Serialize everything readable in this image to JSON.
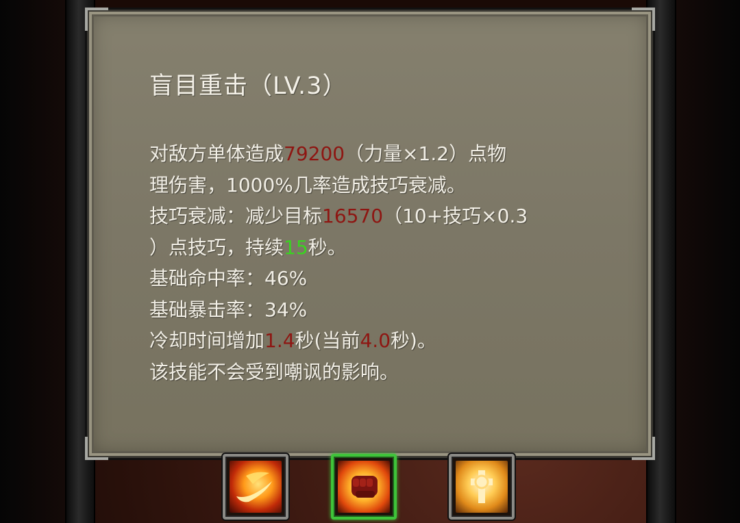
{
  "skill": {
    "title": "盲目重击（LV.3）",
    "lines": [
      [
        {
          "t": "对敌方单体造成"
        },
        {
          "t": "79200",
          "c": "red"
        },
        {
          "t": "（力量×1.2）点物"
        }
      ],
      [
        {
          "t": "理伤害，1000%几率造成技巧衰减。"
        }
      ],
      [
        {
          "t": "技巧衰减：减少目标"
        },
        {
          "t": "16570",
          "c": "red"
        },
        {
          "t": "（10+技巧×0.3"
        }
      ],
      [
        {
          "t": "）点技巧，持续"
        },
        {
          "t": "15",
          "c": "green"
        },
        {
          "t": "秒。"
        }
      ],
      [
        {
          "t": "基础命中率：46%"
        }
      ],
      [
        {
          "t": "基础暴击率：34%"
        }
      ],
      [
        {
          "t": "冷却时间增加"
        },
        {
          "t": "1.4",
          "c": "red"
        },
        {
          "t": "秒(当前"
        },
        {
          "t": "4.0",
          "c": "red"
        },
        {
          "t": "秒)。"
        }
      ],
      [
        {
          "t": "该技能不会受到嘲讽的影响。"
        }
      ]
    ]
  },
  "skill_bar": [
    {
      "icon": "flaming-slash-icon",
      "selected": false
    },
    {
      "icon": "fist-icon",
      "selected": true
    },
    {
      "icon": "holy-cross-icon",
      "selected": false
    }
  ],
  "colors": {
    "highlight_red": "#8e1612",
    "highlight_green": "#39d420",
    "selected_border": "#3fc43a"
  }
}
